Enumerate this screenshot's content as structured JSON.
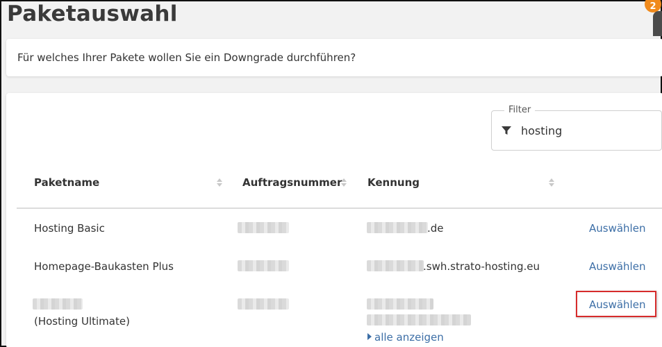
{
  "page": {
    "title": "Paketauswahl",
    "notification_count": "2"
  },
  "question": {
    "text": "Für welches Ihrer Pakete wollen Sie ein Downgrade durchführen?"
  },
  "filter": {
    "label": "Filter",
    "value": "hosting",
    "icon": "funnel-icon"
  },
  "table": {
    "columns": [
      "Paketname",
      "Auftragsnummer",
      "Kennung"
    ],
    "rows": [
      {
        "name": "Hosting Basic",
        "kennung_suffix": ".de",
        "action": "Auswählen"
      },
      {
        "name": "Homepage-Baukasten Plus",
        "kennung_suffix": ".swh.strato-hosting.eu",
        "action": "Auswählen"
      },
      {
        "name_sub": "(Hosting Ultimate)",
        "action": "Auswählen",
        "show_all": "alle anzeigen"
      }
    ]
  },
  "colors": {
    "link": "#3c6ea6",
    "highlight": "#d62b2b",
    "badge": "#f08a1c"
  }
}
